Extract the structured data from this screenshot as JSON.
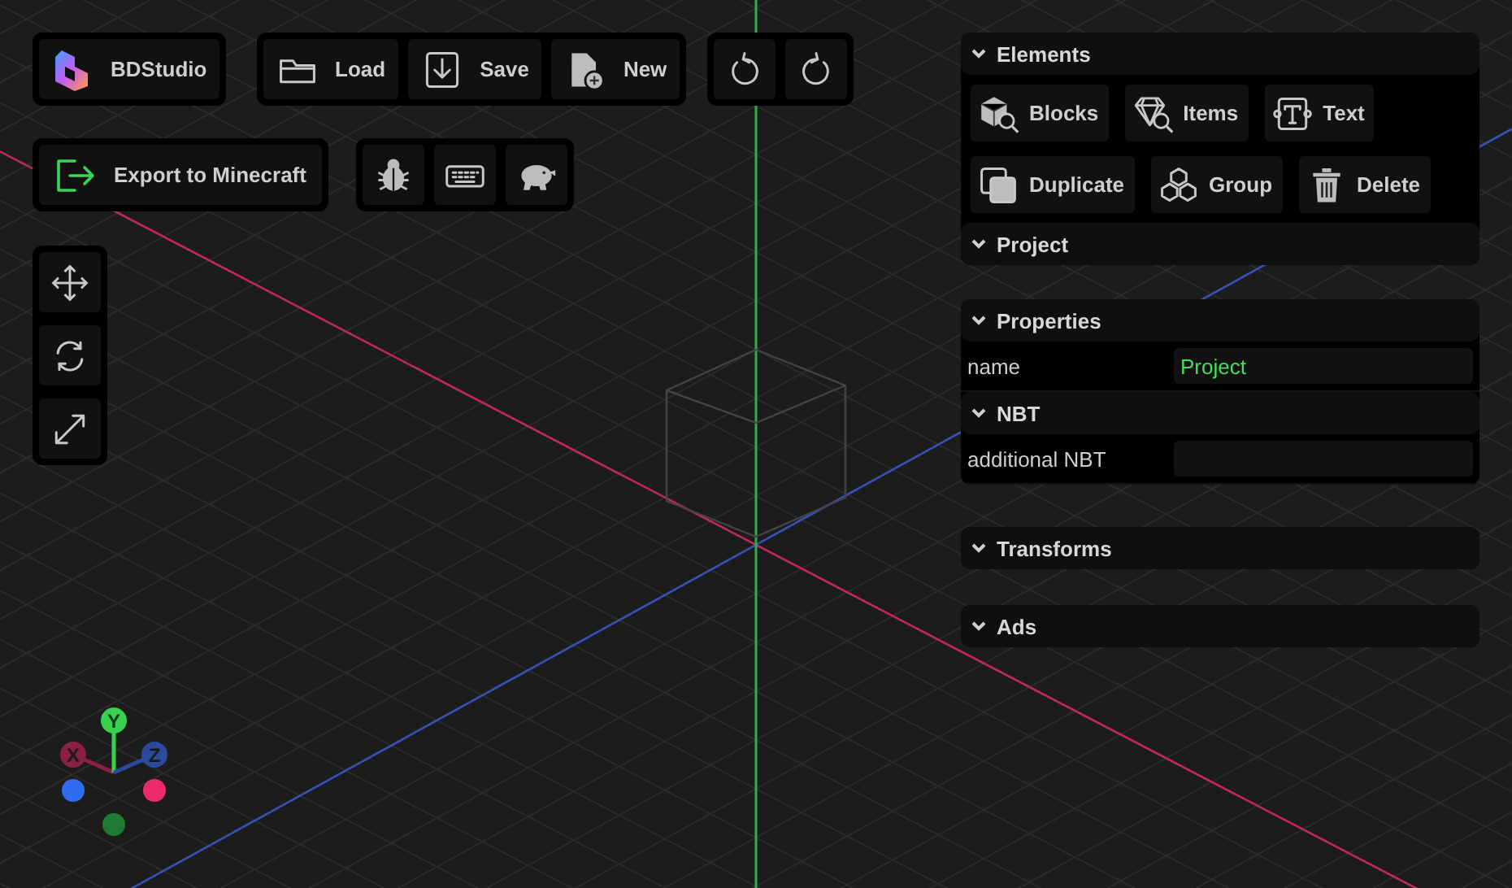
{
  "toolbar": {
    "brand": {
      "label": "BDStudio"
    },
    "file_buttons": [
      {
        "kind": "load",
        "label": "Load"
      },
      {
        "kind": "save",
        "label": "Save"
      },
      {
        "kind": "new",
        "label": "New"
      }
    ],
    "history_buttons": [
      {
        "kind": "undo"
      },
      {
        "kind": "redo"
      }
    ],
    "export_button": {
      "label": "Export to Minecraft"
    },
    "tool_buttons": [
      {
        "kind": "bug"
      },
      {
        "kind": "keyboard"
      },
      {
        "kind": "piggy"
      }
    ]
  },
  "transform_tools": [
    {
      "kind": "move"
    },
    {
      "kind": "rotate"
    },
    {
      "kind": "scale"
    }
  ],
  "side_panel": {
    "elements": {
      "title": "Elements",
      "add_buttons": [
        {
          "kind": "blocks",
          "label": "Blocks"
        },
        {
          "kind": "items",
          "label": "Items"
        },
        {
          "kind": "text",
          "label": "Text"
        }
      ],
      "action_buttons": [
        {
          "kind": "duplicate",
          "label": "Duplicate"
        },
        {
          "kind": "group",
          "label": "Group"
        },
        {
          "kind": "delete",
          "label": "Delete"
        }
      ],
      "project": {
        "title": "Project"
      }
    },
    "properties": {
      "title": "Properties",
      "fields": [
        {
          "label": "name",
          "value": "Project"
        }
      ],
      "nbt": {
        "title": "NBT",
        "fields": [
          {
            "label": "additional NBT"
          }
        ]
      }
    },
    "sections": [
      {
        "title": "Transforms"
      },
      {
        "title": "Ads"
      }
    ]
  },
  "gizmo": {
    "axes": [
      {
        "label": "X",
        "color": "#8c1f45"
      },
      {
        "label": "Y",
        "color": "#38d14f"
      },
      {
        "label": "Z",
        "color": "#2a4a9e"
      }
    ],
    "dots": [
      {
        "color": "#2f6cf0"
      },
      {
        "color": "#ee2a6d"
      },
      {
        "color": "#1f7a34"
      }
    ]
  }
}
